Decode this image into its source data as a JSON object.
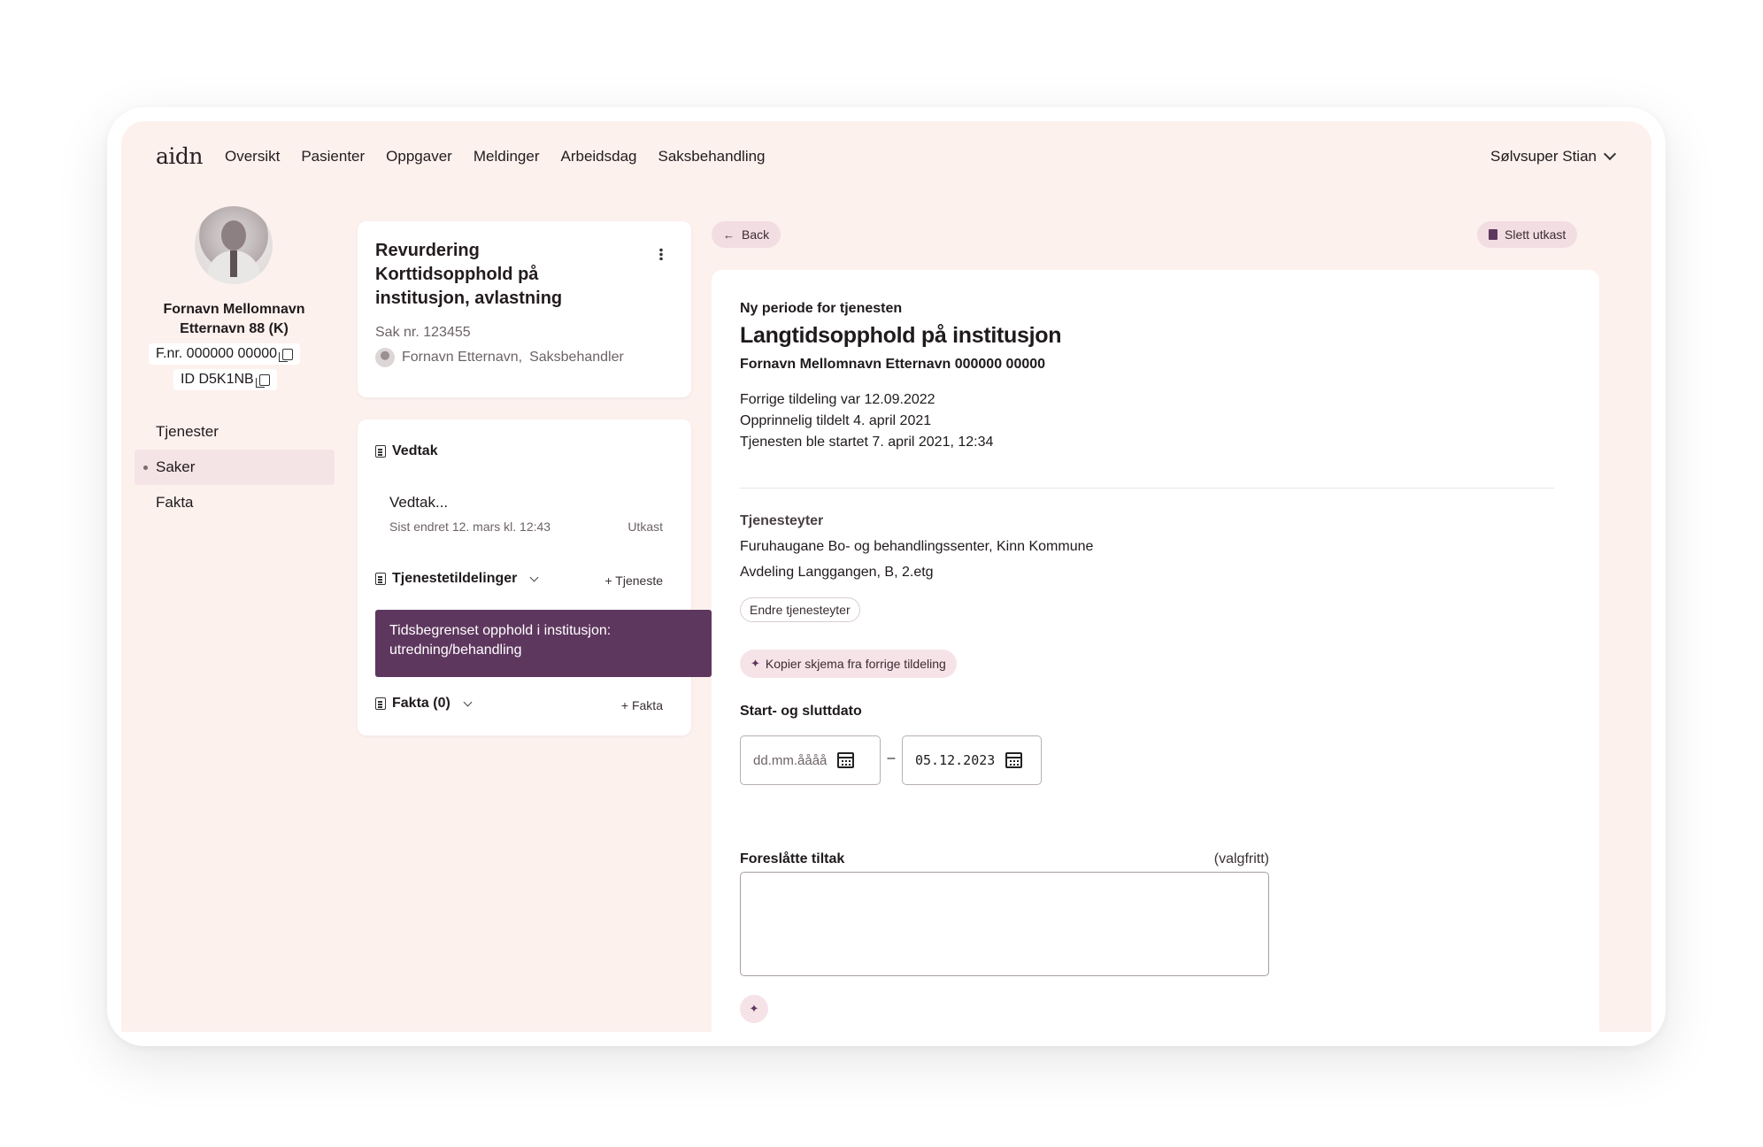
{
  "app": {
    "logo": "aidn",
    "nav": [
      "Oversikt",
      "Pasienter",
      "Oppgaver",
      "Meldinger",
      "Arbeidsdag",
      "Saksbehandling"
    ],
    "user": "Sølvsuper Stian"
  },
  "patient": {
    "name": "Fornavn Mellomnavn Etternavn 88 (K)",
    "fnr": "F.nr. 000000 00000",
    "id": "ID D5K1NB",
    "menu": [
      "Tjenester",
      "Saker",
      "Fakta"
    ],
    "active_menu": "Saker"
  },
  "case": {
    "title": "Revurdering Korttidsopphold på institusjon, avlastning",
    "number": "Sak nr. 123455",
    "handler": "Fornavn Etternavn,",
    "handler_role": "Saksbehandler"
  },
  "vedtak": {
    "heading": "Vedtak",
    "item_title": "Vedtak...",
    "item_meta": "Sist endret 12. mars kl. 12:43",
    "item_status": "Utkast",
    "services_heading": "Tjenestetildelinger",
    "add_service": "+ Tjeneste",
    "service_item": "Tidsbegrenset opphold i institusjon: utredning/behandling",
    "facts_heading": "Fakta (0)",
    "add_fact": "+ Fakta"
  },
  "detail": {
    "back": "Back",
    "delete_draft": "Slett utkast",
    "eyebrow": "Ny periode for tjenesten",
    "title": "Langtidsopphold på institusjon",
    "patient_line": "Fornavn Mellomnavn Etternavn 000000 00000",
    "history": [
      "Forrige tildeling var 12.09.2022",
      "Opprinnelig tildelt 4. april 2021",
      "Tjenesten ble startet 7. april 2021, 12:34"
    ],
    "provider_label": "Tjenesteyter",
    "provider_name": "Furuhaugane Bo- og behandlingssenter, Kinn Kommune",
    "provider_unit": "Avdeling Langgangen, B, 2.etg",
    "change_provider": "Endre tjenesteyter",
    "copy_form": "Kopier skjema fra forrige tildeling",
    "dates_label": "Start- og sluttdato",
    "start_placeholder": "dd.mm.åååå",
    "date_separator": "–",
    "end_date": "05.12.2023",
    "measures_label": "Foreslåtte tiltak",
    "optional": "(valgfritt)"
  },
  "colors": {
    "screen_bg": "#fdf1ee",
    "accent": "#5e375e",
    "pill_bg": "#f2dde2"
  }
}
